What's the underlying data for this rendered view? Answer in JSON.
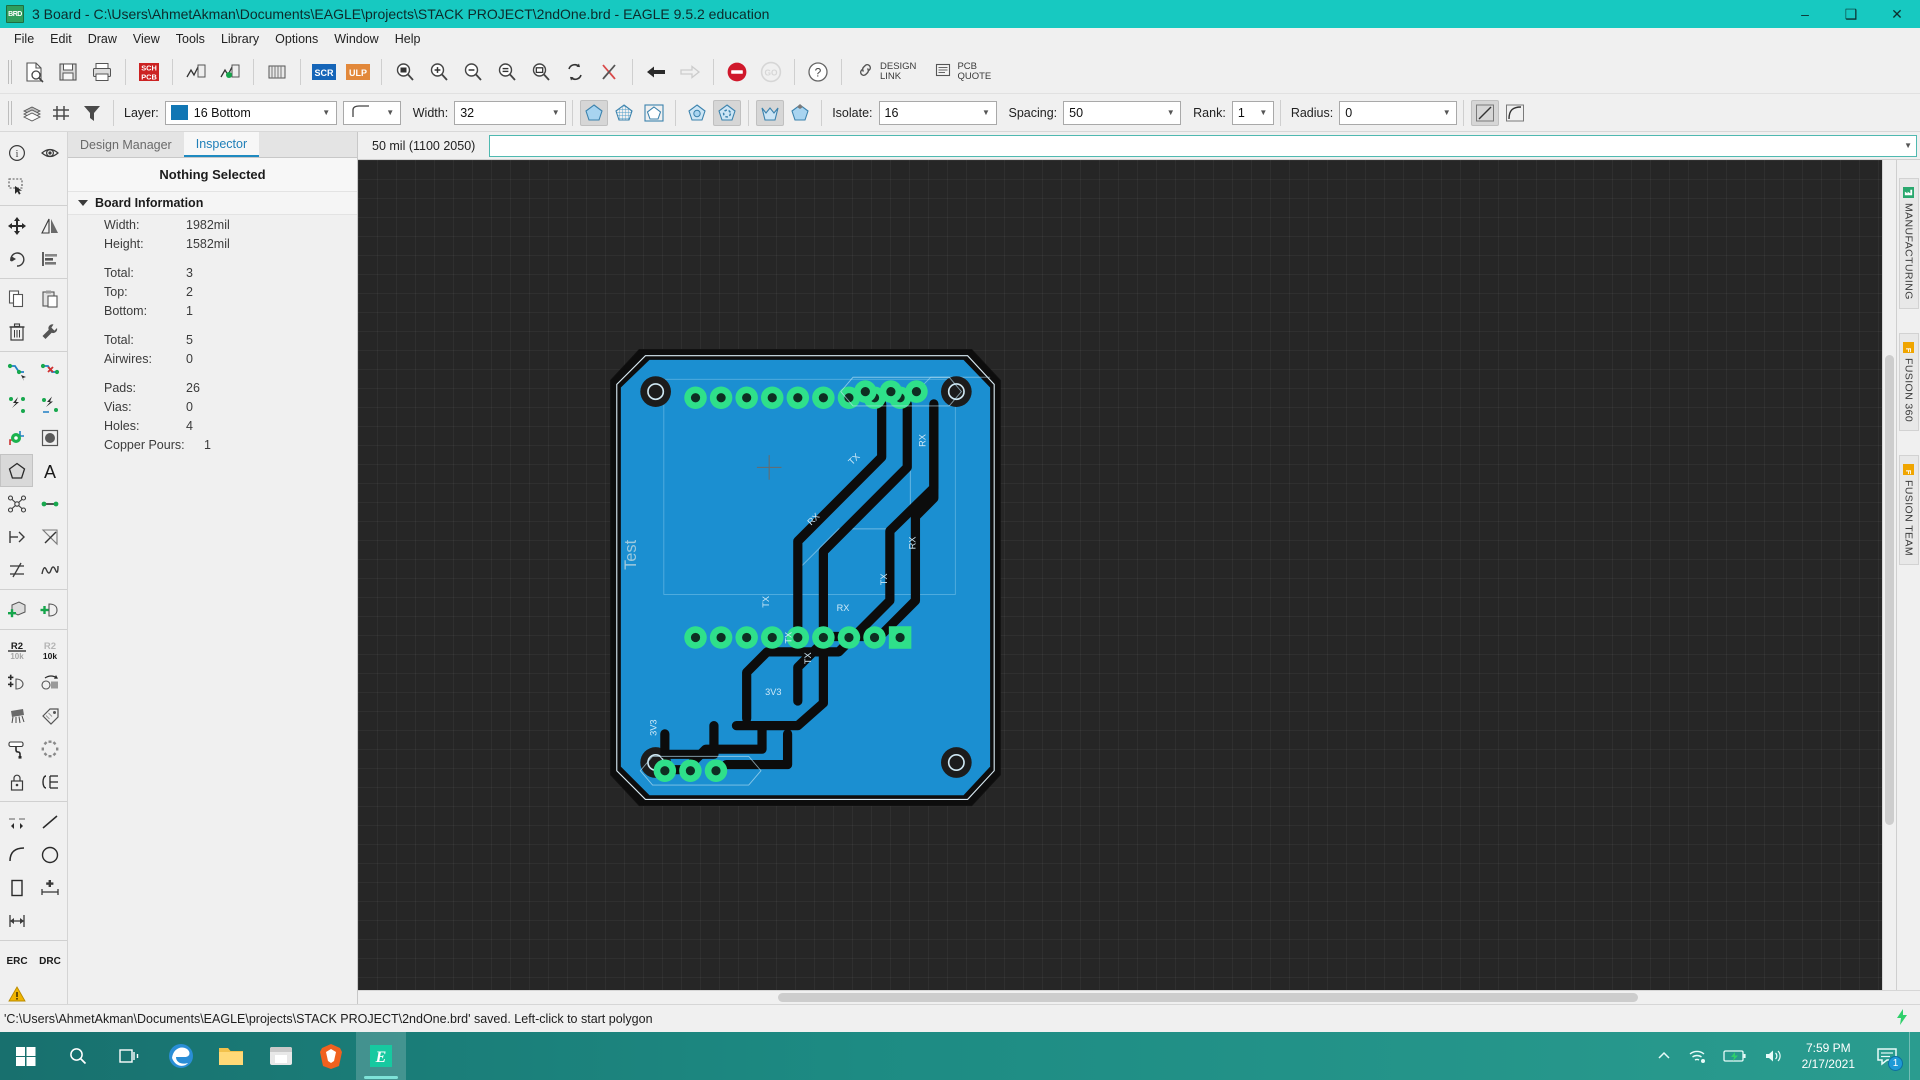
{
  "window": {
    "title": "3 Board - C:\\Users\\AhmetAkman\\Documents\\EAGLE\\projects\\STACK PROJECT\\2ndOne.brd - EAGLE 9.5.2 education",
    "app_icon": "brd-file-icon",
    "minimize": "–",
    "maximize": "❑",
    "close": "✕"
  },
  "menu": {
    "items": [
      "File",
      "Edit",
      "Draw",
      "View",
      "Tools",
      "Library",
      "Options",
      "Window",
      "Help"
    ]
  },
  "toolbar": {
    "buttons": [
      {
        "name": "open-file-button",
        "icon": "open-file-icon"
      },
      {
        "name": "save-button",
        "icon": "floppy-save-icon"
      },
      {
        "name": "print-button",
        "icon": "printer-icon"
      },
      {
        "name": "cam-processor-button",
        "icon": "sch-pcb-icon"
      },
      {
        "name": "switch-to-board-button",
        "icon": "board-icon"
      },
      {
        "name": "generate-board-button",
        "icon": "board-green-icon"
      },
      {
        "name": "library-button",
        "icon": "library-icon"
      },
      {
        "name": "script-button",
        "icon": "scr-icon"
      },
      {
        "name": "ulp-button",
        "icon": "ulp-icon"
      },
      {
        "name": "zoom-fit-button",
        "icon": "zoom-fit-icon"
      },
      {
        "name": "zoom-in-button",
        "icon": "zoom-in-icon"
      },
      {
        "name": "zoom-out-button",
        "icon": "zoom-out-icon"
      },
      {
        "name": "zoom-select-button",
        "icon": "zoom-select-icon"
      },
      {
        "name": "zoom-region-button",
        "icon": "zoom-region-icon"
      },
      {
        "name": "redraw-button",
        "icon": "refresh-icon"
      },
      {
        "name": "drc-clear-button",
        "icon": "x-red-icon"
      },
      {
        "name": "undo-button",
        "icon": "undo-arrow-icon"
      },
      {
        "name": "redo-button",
        "icon": "redo-arrow-icon",
        "disabled": true
      },
      {
        "name": "stop-button",
        "icon": "stop-sign-icon"
      },
      {
        "name": "go-button",
        "icon": "go-circle-icon",
        "disabled": true
      },
      {
        "name": "help-button",
        "icon": "question-help-icon"
      }
    ],
    "design_link": {
      "line1": "DESIGN",
      "line2": "LINK",
      "icon": "link-chain-icon"
    },
    "pcb_quote": {
      "line1": "PCB",
      "line2": "QUOTE",
      "icon": "document-lines-icon"
    }
  },
  "options_bar": {
    "layer_label": "Layer:",
    "layer_value": "16 Bottom",
    "layer_color": "#1076b4",
    "wire_bend_icon": "wire-bend-style-icon",
    "width_label": "Width:",
    "width_value": "32",
    "isolate_label": "Isolate:",
    "isolate_value": "16",
    "spacing_label": "Spacing:",
    "spacing_value": "50",
    "rank_label": "Rank:",
    "rank_value": "1",
    "radius_label": "Radius:",
    "radius_value": "0",
    "pour_buttons": [
      {
        "name": "pour-solid-button",
        "icon": "polygon-solid-icon",
        "active": true
      },
      {
        "name": "pour-hatch-button",
        "icon": "polygon-hatch-icon",
        "active": false
      },
      {
        "name": "pour-cutout-button",
        "icon": "polygon-cutout-icon",
        "active": false
      },
      {
        "name": "thermals-off-button",
        "icon": "polygon-thermals-off-icon",
        "active": false
      },
      {
        "name": "thermals-on-button",
        "icon": "polygon-thermals-on-icon",
        "active": true
      },
      {
        "name": "orphans-off-button",
        "icon": "polygon-orphans-off-icon",
        "active": true
      },
      {
        "name": "orphans-on-button",
        "icon": "polygon-orphans-on-icon",
        "active": false
      }
    ],
    "corner_buttons": [
      {
        "name": "miter-straight-button",
        "icon": "miter-straight-icon",
        "active": true
      },
      {
        "name": "miter-round-button",
        "icon": "miter-round-icon",
        "active": false
      }
    ]
  },
  "palette": {
    "rows": [
      [
        {
          "name": "info-tool",
          "icon": "info-circle-icon"
        },
        {
          "name": "show-tool",
          "icon": "eye-icon"
        }
      ],
      [
        {
          "name": "group-tool",
          "icon": "marquee-select-icon"
        }
      ],
      [
        {
          "name": "move-tool",
          "icon": "move-arrows-icon"
        },
        {
          "name": "mirror-tool",
          "icon": "mirror-icon"
        }
      ],
      [
        {
          "name": "rotate-tool",
          "icon": "rotate-ccw-icon"
        },
        {
          "name": "align-tool",
          "icon": "align-left-icon"
        }
      ],
      [
        {
          "name": "copy-tool",
          "icon": "copy-pages-icon"
        },
        {
          "name": "paste-tool",
          "icon": "clipboard-paste-icon"
        }
      ],
      [
        {
          "name": "delete-tool",
          "icon": "trash-can-icon"
        },
        {
          "name": "change-tool",
          "icon": "wrench-icon"
        }
      ],
      [
        {
          "name": "route-tool",
          "icon": "route-wire-icon"
        },
        {
          "name": "ripup-tool",
          "icon": "ripup-wire-icon"
        }
      ],
      [
        {
          "name": "autorouter-tool",
          "icon": "autoroute-icon"
        },
        {
          "name": "ratsnest-tool",
          "icon": "ratsnest-icon"
        }
      ],
      [
        {
          "name": "via-tool",
          "icon": "via-green-icon"
        },
        {
          "name": "hole-tool",
          "icon": "hole-pad-icon"
        }
      ],
      [
        {
          "name": "polygon-tool",
          "icon": "polygon-pentagon-icon",
          "active": true
        },
        {
          "name": "text-tool",
          "icon": "text-a-icon"
        }
      ],
      [
        {
          "name": "signal-tool",
          "icon": "signal-net-icon"
        },
        {
          "name": "wire-tool",
          "icon": "wire-line-icon"
        }
      ],
      [
        {
          "name": "meander-tool",
          "icon": "meander-arrow-icon"
        },
        {
          "name": "miter-tool",
          "icon": "miter-corner-icon"
        }
      ],
      [
        {
          "name": "split-tool",
          "icon": "split-wire-icon"
        },
        {
          "name": "length-tool",
          "icon": "wave-length-icon"
        }
      ],
      [
        {
          "name": "add-part-tool",
          "icon": "add-package-icon"
        },
        {
          "name": "add-gate-tool",
          "icon": "add-gate-icon"
        }
      ],
      [
        {
          "name": "name-tool",
          "icon": "name-r2-icon"
        },
        {
          "name": "value-tool",
          "icon": "value-10k-icon"
        }
      ],
      [
        {
          "name": "replace-tool",
          "icon": "replace-gate-icon"
        },
        {
          "name": "update-tool",
          "icon": "update-package-icon"
        }
      ],
      [
        {
          "name": "smash-tool",
          "icon": "smash-icon"
        },
        {
          "name": "attribute-tool",
          "icon": "tag-attribute-icon"
        }
      ],
      [
        {
          "name": "paint-tool",
          "icon": "paint-roller-icon"
        },
        {
          "name": "optimize-tool",
          "icon": "dashed-ring-icon"
        }
      ],
      [
        {
          "name": "lock-tool",
          "icon": "padlock-icon"
        },
        {
          "name": "pinswap-tool",
          "icon": "pinswap-icon"
        }
      ],
      [
        {
          "name": "dimension-tool",
          "icon": "dimension-dash-icon"
        }
      ],
      [
        {
          "name": "line-tool",
          "icon": "line-diagonal-icon"
        },
        {
          "name": "arc-tool",
          "icon": "arc-curve-icon"
        }
      ],
      [
        {
          "name": "circle-tool",
          "icon": "circle-outline-icon"
        },
        {
          "name": "rect-tool",
          "icon": "rectangle-outline-icon"
        }
      ],
      [
        {
          "name": "hplus-tool",
          "icon": "measure-plus-icon"
        },
        {
          "name": "hmeasure-tool",
          "icon": "measure-arrows-icon"
        }
      ],
      [
        {
          "name": "erc-tool",
          "icon": "erc-text-icon",
          "label": "ERC"
        },
        {
          "name": "drc-tool",
          "icon": "drc-text-icon",
          "label": "DRC"
        }
      ],
      [
        {
          "name": "errors-tool",
          "icon": "warning-triangle-icon"
        }
      ]
    ]
  },
  "left_panel": {
    "tabs": [
      {
        "label": "Design Manager",
        "active": false
      },
      {
        "label": "Inspector",
        "active": true
      }
    ],
    "selection_status": "Nothing Selected",
    "section_title": "Board Information",
    "rows": [
      {
        "key": "Width:",
        "value": "1982mil"
      },
      {
        "key": "Height:",
        "value": "1582mil"
      },
      {
        "gap": true
      },
      {
        "key": "Total:",
        "value": "3"
      },
      {
        "key": "Top:",
        "value": "2"
      },
      {
        "key": "Bottom:",
        "value": "1"
      },
      {
        "gap": true
      },
      {
        "key": "Total:",
        "value": "5"
      },
      {
        "key": "Airwires:",
        "value": "0"
      },
      {
        "gap": true
      },
      {
        "key": "Pads:",
        "value": "26"
      },
      {
        "key": "Vias:",
        "value": "0"
      },
      {
        "key": "Holes:",
        "value": "4"
      },
      {
        "key": "Copper Pours:",
        "value": "1"
      }
    ]
  },
  "command_bar": {
    "coordinate": "50 mil (1100 2050)",
    "input_value": "",
    "input_placeholder": ""
  },
  "canvas": {
    "board_name": "Test",
    "net_labels": [
      "TX",
      "RX",
      "TX",
      "RX",
      "TX",
      "RX",
      "3V3",
      "3V3"
    ],
    "background_color": "#262626",
    "copper_color": "#1b8fd1",
    "pad_color": "#2fe08a"
  },
  "right_rail": {
    "tabs": [
      {
        "label": "MANUFACTURING",
        "icon": "manufacturing-icon"
      },
      {
        "label": "FUSION 360",
        "icon": "fusion-360-icon"
      },
      {
        "label": "FUSION TEAM",
        "icon": "fusion-team-icon"
      }
    ]
  },
  "status_bar": {
    "message": "'C:\\Users\\AhmetAkman\\Documents\\EAGLE\\projects\\STACK PROJECT\\2ndOne.brd' saved. Left-click to start polygon",
    "right_icon": "green-lightning-icon"
  },
  "taskbar": {
    "start": "windows-start-icon",
    "search": "search-icon",
    "task_view": "task-view-icon",
    "apps": [
      {
        "name": "taskbar-edge",
        "icon": "edge-browser-icon",
        "active": false
      },
      {
        "name": "taskbar-file-explorer",
        "icon": "file-explorer-icon",
        "active": false
      },
      {
        "name": "taskbar-microsoft-store",
        "icon": "microsoft-store-icon",
        "active": false
      },
      {
        "name": "taskbar-brave",
        "icon": "brave-browser-icon",
        "active": false
      },
      {
        "name": "taskbar-eagle",
        "icon": "eagle-app-icon",
        "active": true
      }
    ],
    "tray": [
      {
        "name": "show-hidden-icons",
        "icon": "chevron-up-icon"
      },
      {
        "name": "network-icon",
        "icon": "wifi-icon"
      },
      {
        "name": "battery-icon",
        "icon": "battery-charging-icon"
      },
      {
        "name": "volume-icon",
        "icon": "speaker-icon"
      }
    ],
    "time": "7:59 PM",
    "date": "2/17/2021",
    "notification_count": "1"
  }
}
